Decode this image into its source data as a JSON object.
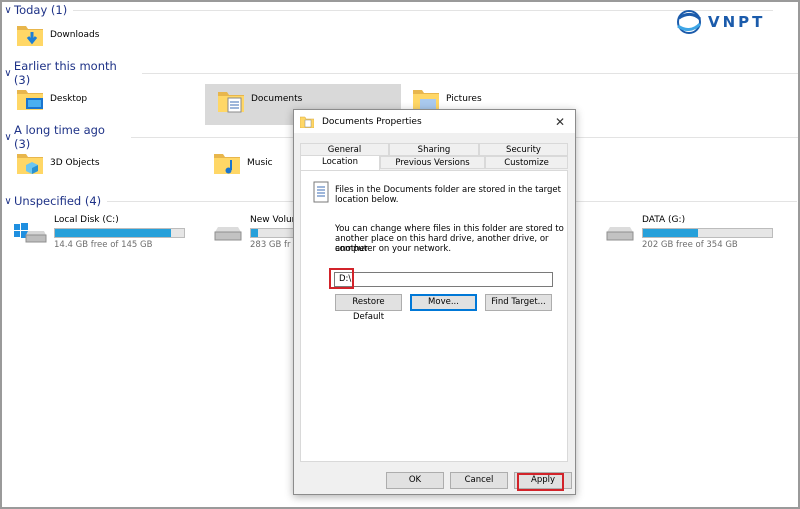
{
  "groups": [
    {
      "title": "Today (1)"
    },
    {
      "title": "Earlier this month (3)"
    },
    {
      "title": "A long time ago (3)"
    },
    {
      "title": "Unspecified (4)"
    }
  ],
  "items": {
    "downloads": "Downloads",
    "desktop": "Desktop",
    "documents": "Documents",
    "pictures": "Pictures",
    "objects3d": "3D Objects",
    "music": "Music"
  },
  "drives": [
    {
      "name": "Local Disk (C:)",
      "free": "14.4 GB free of 145 GB",
      "used_fraction": 0.9
    },
    {
      "name": "New Volum",
      "free": "283 GB fr",
      "used_fraction": 0.15
    },
    {
      "name": "DATA (G:)",
      "free": "202 GB free of 354 GB",
      "used_fraction": 0.43
    }
  ],
  "logo": {
    "text": "VNPT",
    "color": "#1b5bab"
  },
  "dialog": {
    "title": "Documents Properties",
    "close": "✕",
    "tabs_row1": [
      "General",
      "Sharing",
      "Security"
    ],
    "tabs_row2": [
      "Location",
      "Previous Versions",
      "Customize"
    ],
    "intro_line1": "Files in the Documents folder are stored in the target",
    "intro_line2": "location below.",
    "desc_line1": "You can change where files in this folder are stored to",
    "desc_line2": "another place on this hard drive, another drive, or another",
    "desc_line3": "computer on your network.",
    "path": "D:\\",
    "restore": "Restore Default",
    "move": "Move...",
    "find_target": "Find Target...",
    "ok": "OK",
    "cancel": "Cancel",
    "apply": "Apply"
  },
  "colors": {
    "accent": "#0078d7",
    "highlight": "#d2232a",
    "header": "#1e3287",
    "bar": "#26a0da"
  }
}
